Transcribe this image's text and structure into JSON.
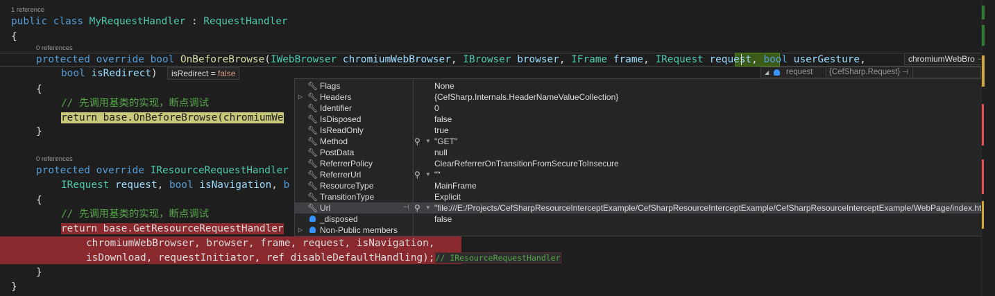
{
  "code": {
    "lens1": "1 reference",
    "line_class": [
      "public",
      "class",
      "MyRequestHandler",
      ":",
      "RequestHandler"
    ],
    "brace_open": "{",
    "lens2": "0 references",
    "line_m1a": [
      "protected",
      "override",
      "bool",
      "OnBeforeBrowse",
      "(",
      "IWebBrowser",
      "chromiumWebBrowser",
      ", ",
      "IBrowser",
      "browser",
      ", ",
      "IFrame",
      "frame",
      ", ",
      "IRequest",
      "request",
      ", ",
      "bool",
      "userGesture",
      ","
    ],
    "line_m1b": [
      "bool",
      "isRedirect",
      ")"
    ],
    "brace_m1_open": "{",
    "comment1": "// 先调用基类的实现，断点调试",
    "return1": "return base.OnBeforeBrowse(chromiumWe",
    "brace_m1_close": "}",
    "lens3": "0 references",
    "line_m2a": [
      "protected",
      "override",
      "IResourceRequestHandler"
    ],
    "line_m2b": [
      "IRequest",
      "request",
      ", ",
      "bool",
      "isNavigation",
      ", ",
      "b"
    ],
    "brace_m2_open": "{",
    "comment2": "// 先调用基类的实现，断点调试",
    "return2": "return base.GetResourceRequestHandler",
    "args1": "chromiumWebBrowser, browser, frame, request, isNavigation,",
    "args2": "isDownload, requestInitiator, ref disableDefaultHandling);",
    "inline_hint": "// IResourceRequestHandler",
    "brace_m2_close": "}",
    "brace_close": "}"
  },
  "datatips": {
    "isRedirect": {
      "name": "isRedirect",
      "eq": " = ",
      "value": "false"
    },
    "chromium": {
      "label": "chromiumWebBro"
    },
    "request": {
      "name": "request",
      "value": "{CefSharp.Request}"
    }
  },
  "members": [
    {
      "name": "Flags",
      "value": "None",
      "icon": "wrench-icon",
      "expandable": false,
      "magnifier": false
    },
    {
      "name": "Headers",
      "value": "{CefSharp.Internals.HeaderNameValueCollection}",
      "icon": "wrench-icon",
      "expandable": true,
      "magnifier": false
    },
    {
      "name": "Identifier",
      "value": "0",
      "icon": "wrench-icon",
      "expandable": false,
      "magnifier": false
    },
    {
      "name": "IsDisposed",
      "value": "false",
      "icon": "wrench-icon",
      "expandable": false,
      "magnifier": false
    },
    {
      "name": "IsReadOnly",
      "value": "true",
      "icon": "wrench-icon",
      "expandable": false,
      "magnifier": false
    },
    {
      "name": "Method",
      "value": "\"GET\"",
      "icon": "wrench-icon",
      "expandable": false,
      "magnifier": true
    },
    {
      "name": "PostData",
      "value": "null",
      "icon": "wrench-icon",
      "expandable": false,
      "magnifier": false
    },
    {
      "name": "ReferrerPolicy",
      "value": "ClearReferrerOnTransitionFromSecureToInsecure",
      "icon": "wrench-icon",
      "expandable": false,
      "magnifier": false
    },
    {
      "name": "ReferrerUrl",
      "value": "\"\"",
      "icon": "wrench-icon",
      "expandable": false,
      "magnifier": true
    },
    {
      "name": "ResourceType",
      "value": "MainFrame",
      "icon": "wrench-icon",
      "expandable": false,
      "magnifier": false
    },
    {
      "name": "TransitionType",
      "value": "Explicit",
      "icon": "wrench-icon",
      "expandable": false,
      "magnifier": false
    },
    {
      "name": "Url",
      "value": "\"file:///E:/Projects/CefSharpResourceInterceptExample/CefSharpResourceInterceptExample/CefSharpResourceInterceptExample/WebPage/index.html\"",
      "icon": "wrench-icon",
      "expandable": false,
      "magnifier": true,
      "selected": true
    },
    {
      "name": "_disposed",
      "value": "false",
      "icon": "private-field-icon",
      "expandable": false,
      "magnifier": false
    },
    {
      "name": "Non-Public members",
      "value": "",
      "icon": "object-icon",
      "expandable": true,
      "magnifier": false
    }
  ]
}
